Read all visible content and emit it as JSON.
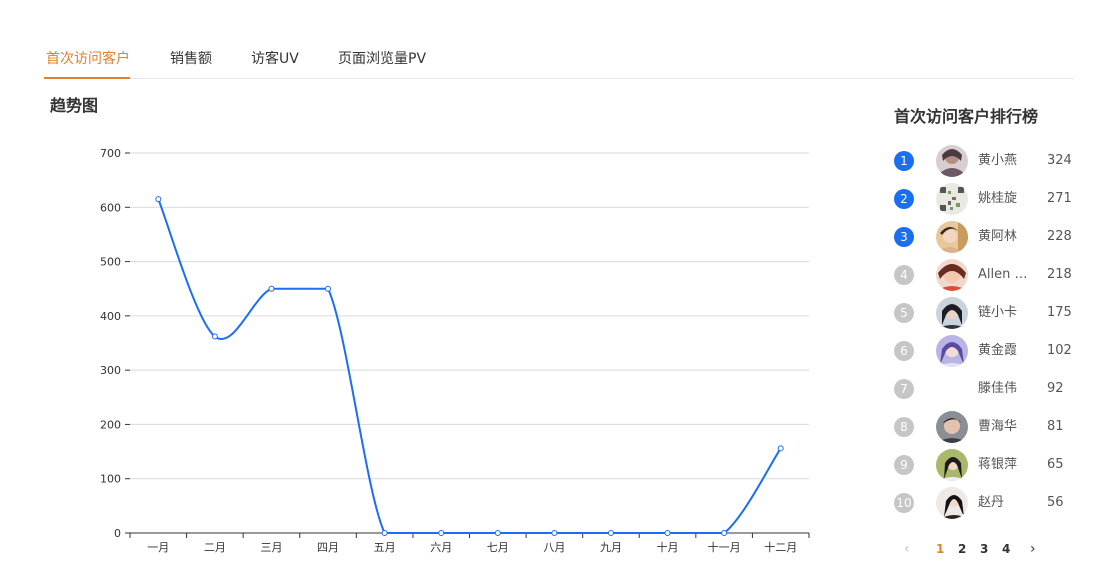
{
  "tabs": [
    {
      "label": "首次访问客户",
      "active": true
    },
    {
      "label": "销售额",
      "active": false
    },
    {
      "label": "访客UV",
      "active": false
    },
    {
      "label": "页面浏览量PV",
      "active": false
    }
  ],
  "trend_title": "趋势图",
  "ranking": {
    "title": "首次访问客户排行榜",
    "items": [
      {
        "rank": "1",
        "name": "黄小燕",
        "value": "324",
        "avatar": "avatar-1"
      },
      {
        "rank": "2",
        "name": "姚桂旋",
        "value": "271",
        "avatar": "avatar-2"
      },
      {
        "rank": "3",
        "name": "黄阿林",
        "value": "228",
        "avatar": "avatar-3"
      },
      {
        "rank": "4",
        "name": "Allen …",
        "value": "218",
        "avatar": "avatar-4"
      },
      {
        "rank": "5",
        "name": "链小卡",
        "value": "175",
        "avatar": "avatar-5"
      },
      {
        "rank": "6",
        "name": "黄金霞",
        "value": "102",
        "avatar": "avatar-6"
      },
      {
        "rank": "7",
        "name": "滕佳伟",
        "value": "92",
        "avatar": ""
      },
      {
        "rank": "8",
        "name": "曹海华",
        "value": "81",
        "avatar": "avatar-8"
      },
      {
        "rank": "9",
        "name": "蒋银萍",
        "value": "65",
        "avatar": "avatar-9"
      },
      {
        "rank": "10",
        "name": "赵丹",
        "value": "56",
        "avatar": "avatar-10"
      }
    ]
  },
  "pagination": {
    "prev_icon": "‹",
    "next_icon": "›",
    "pages": [
      "1",
      "2",
      "3",
      "4"
    ],
    "current": "1"
  },
  "colors": {
    "accent": "#e0812c",
    "line": "#1a6ef0",
    "rank_top": "#1a6ef0",
    "rank_other": "#c6c6c6"
  },
  "chart_data": {
    "type": "line",
    "smooth": true,
    "categories": [
      "一月",
      "二月",
      "三月",
      "四月",
      "五月",
      "六月",
      "七月",
      "八月",
      "九月",
      "十月",
      "十一月",
      "十二月"
    ],
    "values": [
      615,
      362,
      450,
      450,
      0,
      0,
      0,
      0,
      0,
      0,
      0,
      156
    ],
    "ylim": [
      0,
      700
    ],
    "yticks": [
      "0",
      "100",
      "200",
      "300",
      "400",
      "500",
      "600",
      "700"
    ],
    "grid": true,
    "legend": "none"
  }
}
